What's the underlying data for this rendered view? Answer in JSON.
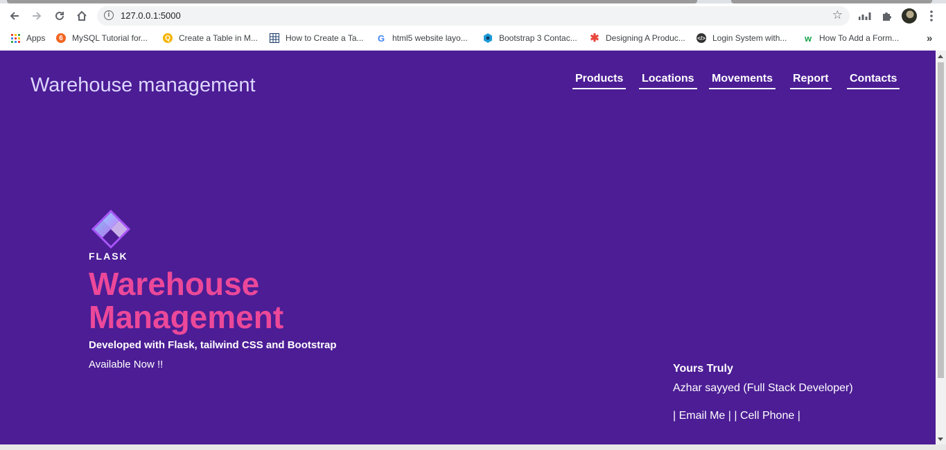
{
  "browser": {
    "url": "127.0.0.1:5000",
    "bookmarks": [
      {
        "label": "Apps",
        "icon": "apps-grid-icon"
      },
      {
        "label": "MySQL Tutorial for...",
        "icon": "mysql-favicon-icon"
      },
      {
        "label": "Create a Table in M...",
        "icon": "search-favicon-icon"
      },
      {
        "label": "How to Create a Ta...",
        "icon": "table-favicon-icon"
      },
      {
        "label": "html5 website layo...",
        "icon": "google-favicon-icon"
      },
      {
        "label": "Bootstrap 3 Contac...",
        "icon": "hexagon-favicon-icon"
      },
      {
        "label": "Designing A Produc...",
        "icon": "asterisk-favicon-icon"
      },
      {
        "label": "Login System with...",
        "icon": "code-favicon-icon"
      },
      {
        "label": "How To Add a Form...",
        "icon": "w-favicon-icon"
      }
    ]
  },
  "site": {
    "brand": "Warehouse management",
    "nav": [
      "Products",
      "Locations",
      "Movements",
      "Report",
      "Contacts"
    ]
  },
  "hero": {
    "logo_text": "FLASK",
    "title_line1": "Warehouse",
    "title_line2": "Management",
    "subtitle": "Developed with Flask, tailwind CSS and Bootstrap",
    "availability": "Available Now !!"
  },
  "footer": {
    "heading": "Yours Truly",
    "author": "Azhar sayyed (Full Stack Developer)",
    "sep_left": "|",
    "email_label": "Email Me",
    "sep_mid": "| |",
    "phone_label": "Cell Phone",
    "sep_right": "|"
  },
  "colors": {
    "page_bg": "#4c1d95",
    "hero_title": "#ec4899",
    "brand": "#ddd6fe"
  }
}
